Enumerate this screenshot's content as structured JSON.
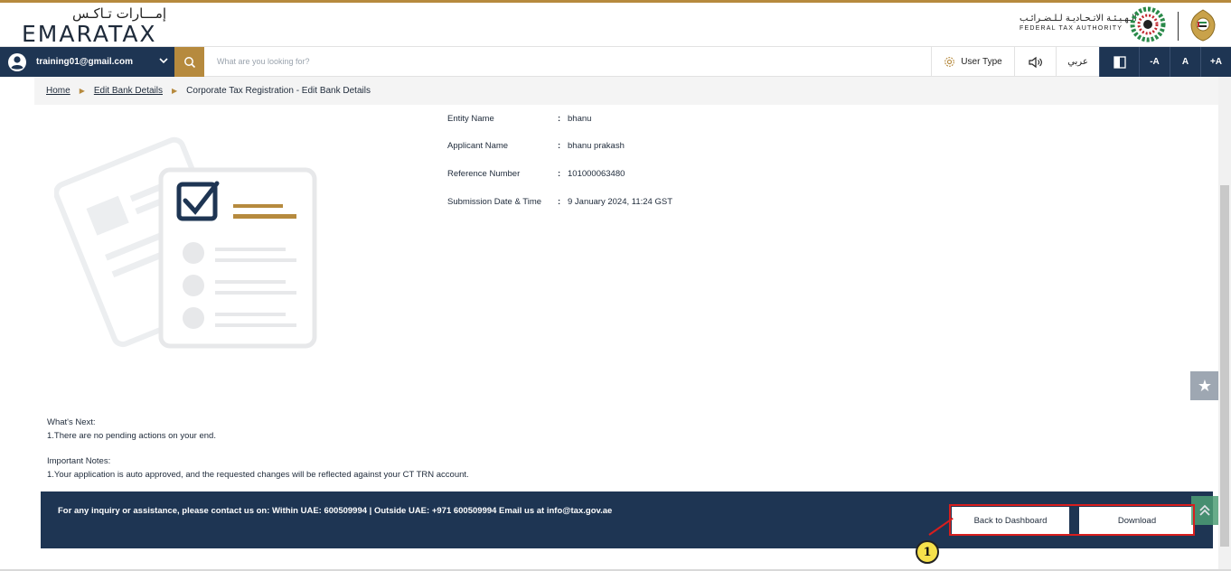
{
  "header": {
    "logo_arabic": "إمـــارات تـاكـس",
    "logo_english": "EMARATAX",
    "fta_arabic": "الـهـيـئـة الاتـحـاديـة لـلـضـرائـب",
    "fta_english": "FEDERAL TAX AUTHORITY"
  },
  "toolbar": {
    "user_email": "training01@gmail.com",
    "search_placeholder": "What are you looking for?",
    "user_type_label": "User Type",
    "arabic_label": "عربي",
    "font_decrease": "-A",
    "font_normal": "A",
    "font_increase": "+A"
  },
  "breadcrumb": {
    "home": "Home",
    "edit_bank": "Edit Bank Details",
    "current": "Corporate Tax Registration - Edit Bank Details",
    "separator": "▶"
  },
  "details": {
    "entity_name_label": "Entity Name",
    "entity_name_value": "bhanu",
    "applicant_name_label": "Applicant Name",
    "applicant_name_value": "bhanu prakash",
    "reference_number_label": "Reference Number",
    "reference_number_value": "101000063480",
    "submission_label": "Submission Date & Time",
    "submission_value": "9 January 2024, 11:24 GST",
    "colon": ":"
  },
  "notes": {
    "whats_next_title": "What's Next:",
    "whats_next_line1": "1.There are no pending actions on your end.",
    "important_title": "Important Notes:",
    "important_line1": "1.Your application is auto approved, and the requested changes will be reflected against your CT TRN account."
  },
  "footer": {
    "inquiry_text": "For any inquiry or assistance, please contact us on: Within UAE: 600509994 | Outside UAE: +971 600509994 Email us at info@tax.gov.ae",
    "back_button": "Back to Dashboard",
    "download_button": "Download"
  },
  "annotation": {
    "callout_number": "1"
  },
  "side": {
    "star_glyph": "★"
  },
  "colors": {
    "navy": "#1e3553",
    "gold": "#b68a3e",
    "highlight_red": "#d81e1e",
    "callout_yellow": "#f6e14b"
  }
}
